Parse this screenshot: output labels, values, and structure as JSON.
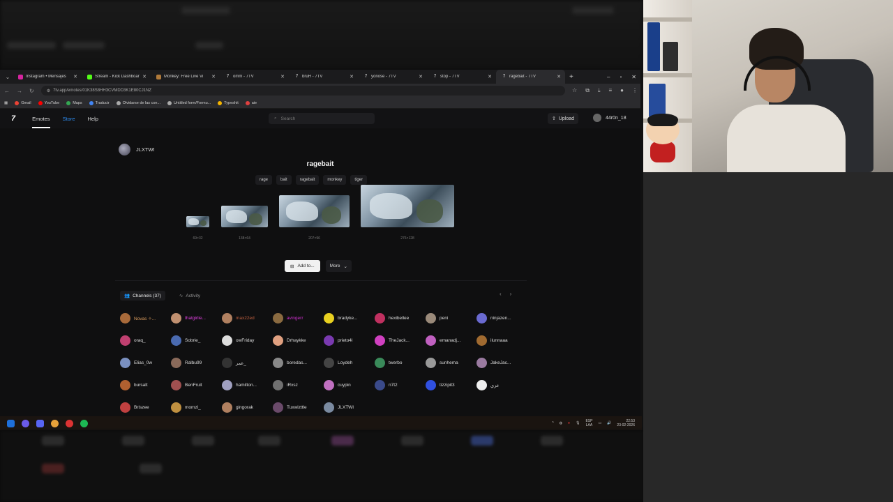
{
  "browser": {
    "tabs": [
      {
        "title": "Instagram • Mensajes",
        "icon": "instagram-icon",
        "color": "#d6249f"
      },
      {
        "title": "Stream - Kick Dashboard",
        "icon": "kick-icon",
        "color": "#53fc18"
      },
      {
        "title": "Monkey: Free Live Vi",
        "icon": "monkey-icon",
        "color": "#b07a3a"
      },
      {
        "title": "omm - 7TV",
        "icon": "7tv-icon",
        "color": "#ffffff"
      },
      {
        "title": "bruH - 7TV",
        "icon": "7tv-icon",
        "color": "#ffffff"
      },
      {
        "title": "yonose - 7TV",
        "icon": "7tv-icon",
        "color": "#ffffff"
      },
      {
        "title": "stop - 7TV",
        "icon": "7tv-icon",
        "color": "#ffffff"
      },
      {
        "title": "ragebait - 7TV",
        "icon": "7tv-icon",
        "color": "#ffffff",
        "active": true
      }
    ],
    "url": "7tv.app/emotes/01K38S8HH3CVMDD3K1E80CJ1NZ",
    "bookmarks": [
      "Gmail",
      "YouTube",
      "Maps",
      "Traducir",
      "Olvidarse de las con...",
      "Untitled form/Formu...",
      "Typeshit",
      "aie"
    ]
  },
  "site": {
    "logo": "7",
    "nav": {
      "emotes": "Emotes",
      "store": "Store",
      "help": "Help"
    },
    "search_placeholder": "Search",
    "upload": "Upload",
    "username": "44r0n_18"
  },
  "emote": {
    "owner": "JLXTWI",
    "name": "ragebait",
    "tags": [
      "rage",
      "bait",
      "ragebait",
      "monkey",
      "tiger"
    ],
    "sizes": [
      "69×32",
      "138×64",
      "207×96",
      "276×128"
    ],
    "add_label": "Add to...",
    "more_label": "More"
  },
  "section": {
    "channels_tab": "Channels (37)",
    "activity_tab": "Activity"
  },
  "channels": [
    {
      "name": "Novas ✧...",
      "color": "#e0a060"
    },
    {
      "name": "thatgirlie...",
      "color": "#e040e0"
    },
    {
      "name": "max22ed",
      "color": "#c06040"
    },
    {
      "name": "avingerr",
      "color": "#d030d0"
    },
    {
      "name": "bradyke...",
      "color": "#dddddd"
    },
    {
      "name": "hexibellee",
      "color": "#dddddd"
    },
    {
      "name": "peni",
      "color": "#dddddd"
    },
    {
      "name": "ninjazen...",
      "color": "#dddddd"
    },
    {
      "name": "oraq_",
      "color": "#dddddd"
    },
    {
      "name": "Sobrie_",
      "color": "#dddddd"
    },
    {
      "name": "owFriday",
      "color": "#dddddd"
    },
    {
      "name": "Drhaykke",
      "color": "#dddddd"
    },
    {
      "name": "prieto4l",
      "color": "#dddddd"
    },
    {
      "name": "TheJack...",
      "color": "#dddddd"
    },
    {
      "name": "emanadj...",
      "color": "#dddddd"
    },
    {
      "name": "ilunnaaa",
      "color": "#dddddd"
    },
    {
      "name": "Elias_0w",
      "color": "#dddddd"
    },
    {
      "name": "Ralbu99",
      "color": "#dddddd"
    },
    {
      "name": "عمر_",
      "color": "#dddddd"
    },
    {
      "name": "boredas...",
      "color": "#dddddd"
    },
    {
      "name": "Loydeh",
      "color": "#dddddd"
    },
    {
      "name": "twerbo",
      "color": "#dddddd"
    },
    {
      "name": "sunhema",
      "color": "#dddddd"
    },
    {
      "name": "JakeJac...",
      "color": "#dddddd"
    },
    {
      "name": "bursalt",
      "color": "#dddddd"
    },
    {
      "name": "BenFruit",
      "color": "#dddddd"
    },
    {
      "name": "hamilton...",
      "color": "#dddddd"
    },
    {
      "name": "iRxsz",
      "color": "#dddddd"
    },
    {
      "name": "cuypin",
      "color": "#dddddd"
    },
    {
      "name": "n7t2",
      "color": "#dddddd"
    },
    {
      "name": "tizzipit3",
      "color": "#dddddd"
    },
    {
      "name": "عزي",
      "color": "#dddddd"
    },
    {
      "name": "Briszee",
      "color": "#dddddd"
    },
    {
      "name": "momzi_",
      "color": "#dddddd"
    },
    {
      "name": "gingorak",
      "color": "#dddddd"
    },
    {
      "name": "Tuxwizttle",
      "color": "#dddddd"
    },
    {
      "name": "JLXTWI",
      "color": "#dddddd"
    }
  ],
  "taskbar": {
    "lang": "ESP",
    "lang2": "LAA",
    "time": "22:53",
    "date": "23-02-2026"
  },
  "colors": {
    "accent_store": "#2d8cf0"
  }
}
